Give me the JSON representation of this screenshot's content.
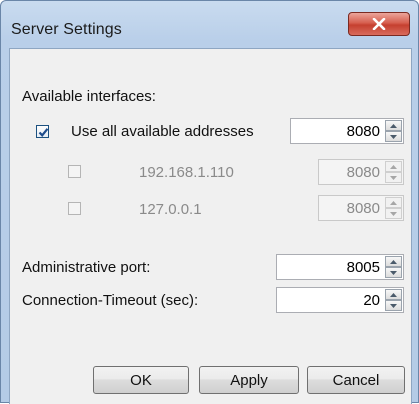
{
  "window": {
    "title": "Server Settings"
  },
  "interfaces": {
    "section_label": "Available interfaces:",
    "use_all": {
      "label": "Use all available addresses",
      "checked": true,
      "port": "8080"
    },
    "addresses": [
      {
        "label": "192.168.1.110",
        "checked": false,
        "port": "8080"
      },
      {
        "label": "127.0.0.1",
        "checked": false,
        "port": "8080"
      }
    ]
  },
  "admin_port": {
    "label": "Administrative port:",
    "value": "8005"
  },
  "timeout": {
    "label": "Connection-Timeout (sec):",
    "value": "20"
  },
  "buttons": {
    "ok": "OK",
    "apply": "Apply",
    "cancel": "Cancel"
  },
  "icons": {
    "close": "close-x-icon",
    "spin_up": "triangle-up-icon",
    "spin_down": "triangle-down-icon",
    "check": "checkmark-icon"
  },
  "colors": {
    "title_bar": "#b9cfe9",
    "close_button": "#c5402f",
    "dialog_background": "#f0f0f0",
    "check_color": "#1f4d8c",
    "disabled_text": "#8a8a8a"
  }
}
